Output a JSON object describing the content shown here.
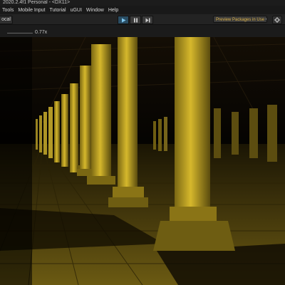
{
  "title_bar": {
    "title": "2020.2.4f1 Personal - <DX11>"
  },
  "menu": {
    "items": [
      {
        "label": "Tools"
      },
      {
        "label": "Mobile Input"
      },
      {
        "label": "Tutorial"
      },
      {
        "label": "uGUI"
      },
      {
        "label": "Window"
      },
      {
        "label": "Help"
      }
    ]
  },
  "toolbar": {
    "pivot_label": "ocal",
    "play_state": "playing",
    "preview_packages_label": "Preview Packages in Use",
    "accent_color": "#ddb34a",
    "play_active_color": "#2a4d63"
  },
  "game_view": {
    "scale_label": "0.77x",
    "scale_value": 0.77
  },
  "scene": {
    "description_color_floor": "#6b5a12",
    "description_color_pillar": "#c9ae2a"
  }
}
